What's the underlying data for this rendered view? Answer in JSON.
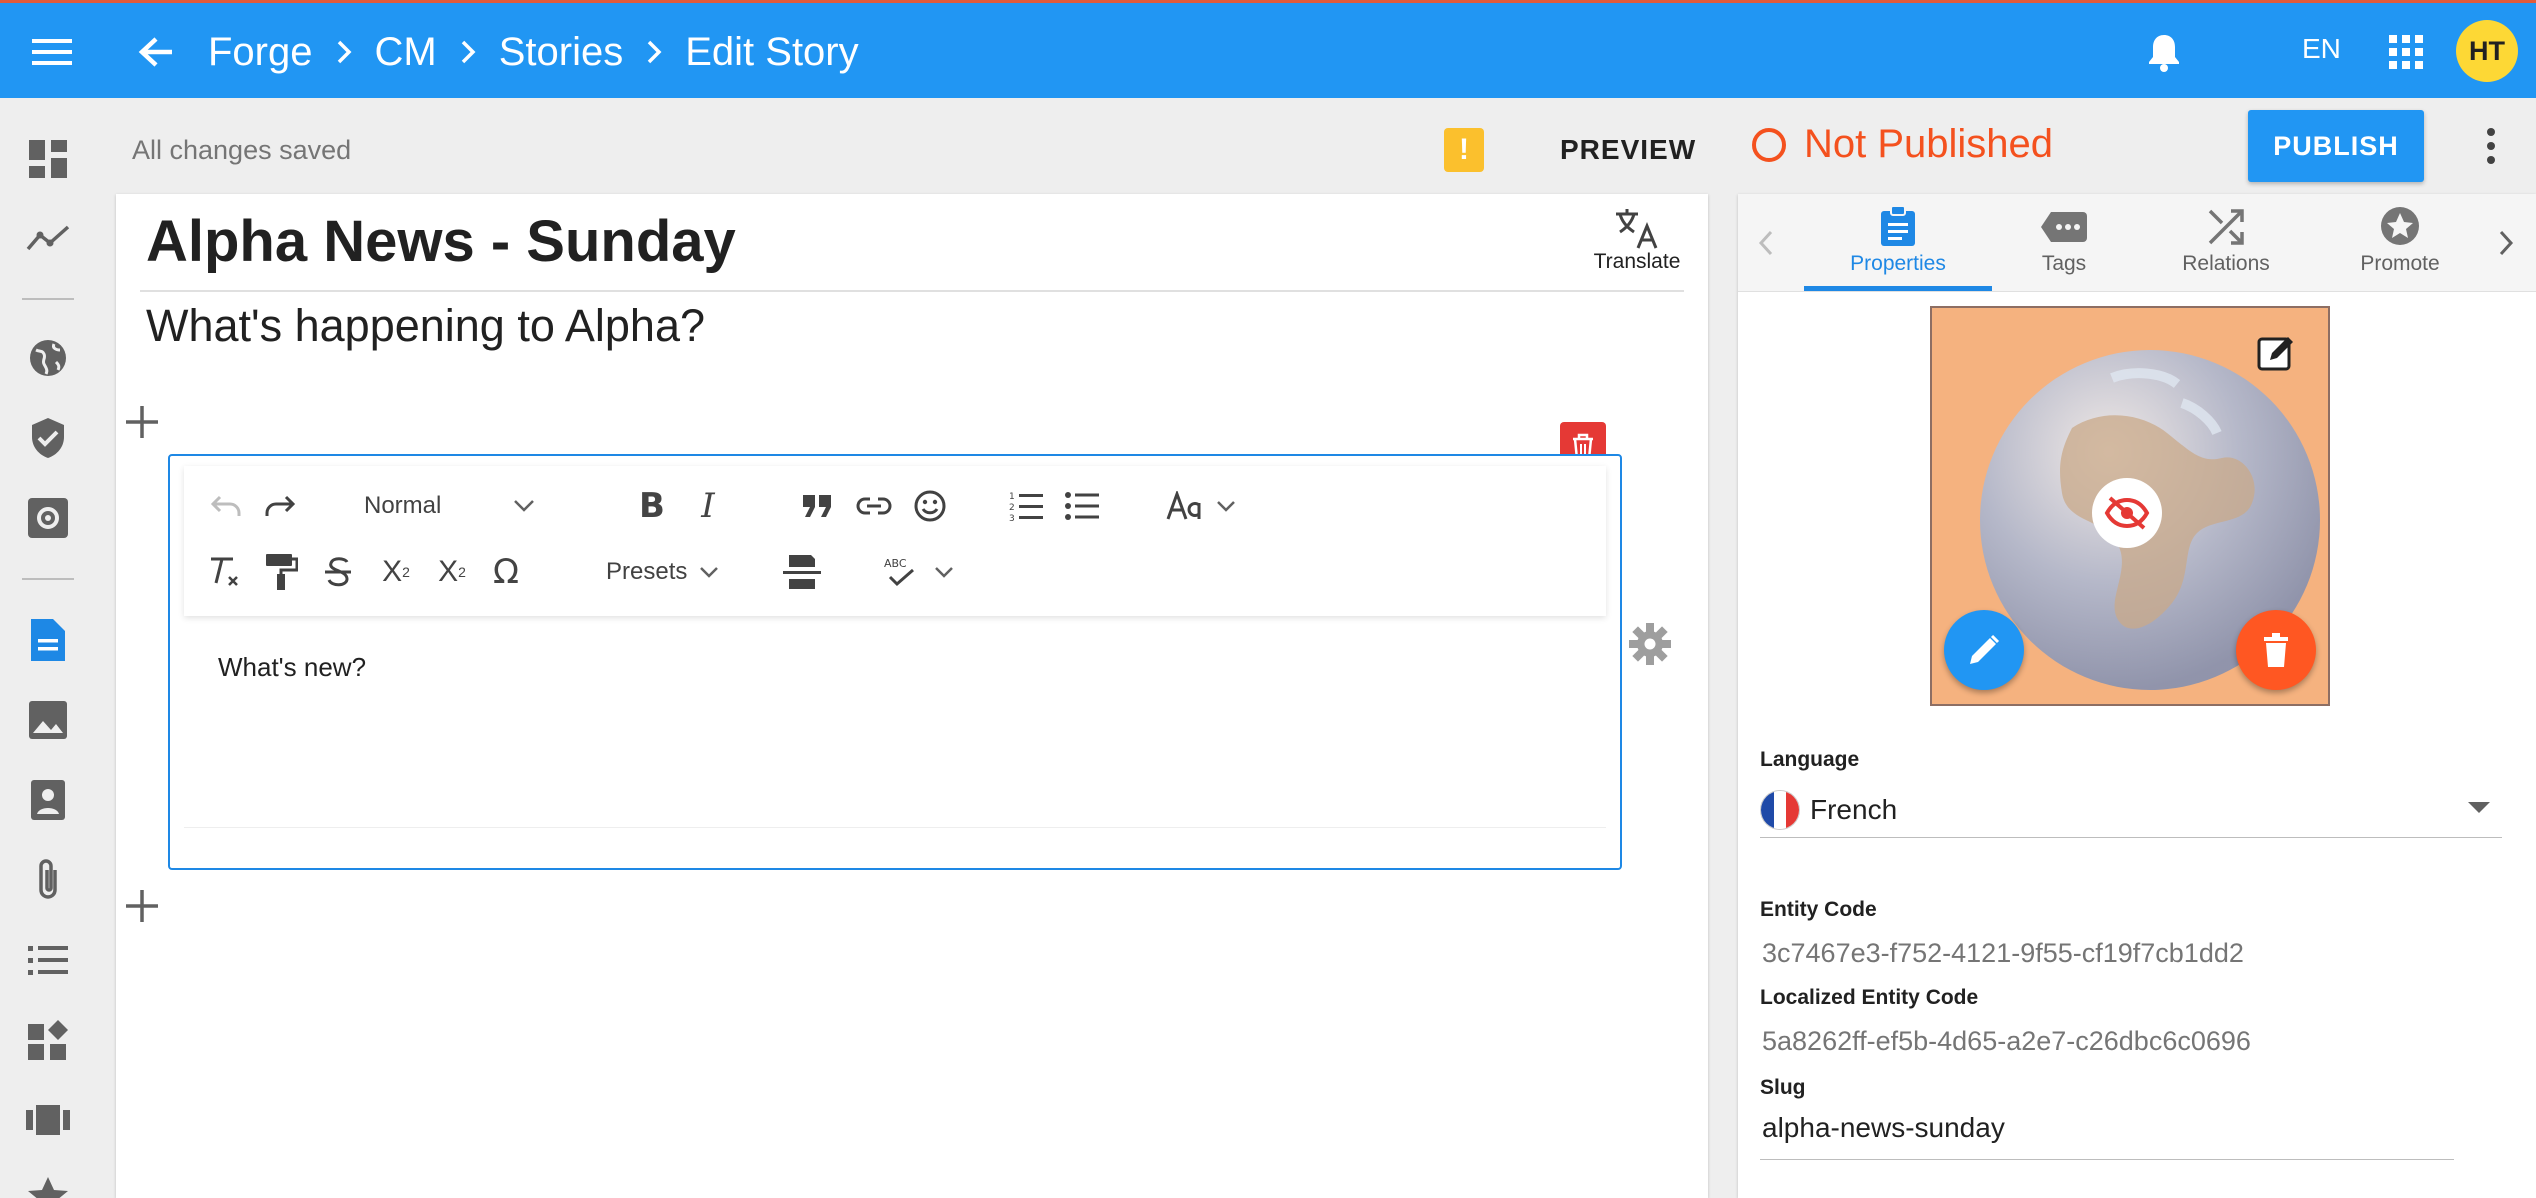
{
  "breadcrumb": [
    "Forge",
    "CM",
    "Stories",
    "Edit Story"
  ],
  "header": {
    "language": "EN",
    "avatar_initials": "HT"
  },
  "toolbar": {
    "save_status": "All changes saved",
    "preview_label": "PREVIEW",
    "publish_status": "Not Published",
    "publish_label": "PUBLISH"
  },
  "story": {
    "title": "Alpha News - Sunday",
    "subtitle": "What's happening to Alpha?",
    "translate_label": "Translate",
    "block_content": "What's new?"
  },
  "rte": {
    "style_select": "Normal",
    "presets_label": "Presets"
  },
  "side_panel": {
    "tabs": [
      "Properties",
      "Tags",
      "Relations",
      "Promote"
    ],
    "active_tab": "Properties",
    "language_label": "Language",
    "language_value": "French",
    "entity_code_label": "Entity Code",
    "entity_code": "3c7467e3-f752-4121-9f55-cf19f7cb1dd2",
    "localized_entity_code_label": "Localized Entity Code",
    "localized_entity_code": "5a8262ff-ef5b-4d65-a2e7-c26dbc6c0696",
    "slug_label": "Slug",
    "slug": "alpha-news-sunday"
  },
  "colors": {
    "primary": "#2196f3",
    "status_error": "#f4511e",
    "warning": "#fbc02d",
    "delete": "#e53935"
  }
}
